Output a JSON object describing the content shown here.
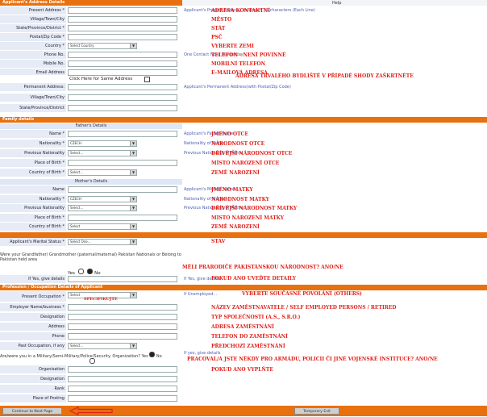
{
  "sections": {
    "applicant_address": "Applicant's Address Details",
    "family": "Family details",
    "profession": "Profession / Occupation Details of Applicant",
    "help": "Help"
  },
  "address_rows": [
    {
      "label": "Present Address *",
      "help": "Applicant's Present Address, Maximum 35 characters (Each Line)",
      "note": "ADRESA KONTAKTNÍ",
      "type": "input"
    },
    {
      "label": "Village/Town/City",
      "help": "",
      "note": "MĚSTO",
      "type": "input"
    },
    {
      "label": "State/Province/District *",
      "help": "",
      "note": "STÁT",
      "type": "input"
    },
    {
      "label": "Postal/Zip Code *",
      "help": "",
      "note": "PSČ",
      "type": "input"
    },
    {
      "label": "Country *",
      "help": "",
      "note": "VYBERTE ZEMI",
      "type": "select",
      "value": "Select Country"
    },
    {
      "label": "Phone No.",
      "help": "One Contact No is Mandatory",
      "note": "TELEFON - NENÍ POVINNÉ",
      "type": "input"
    },
    {
      "label": "Mobile No.",
      "help": "",
      "note": "MOBILNÍ TELEFON",
      "type": "input"
    },
    {
      "label": "Email Address",
      "help": "",
      "note": "E-MAILOVÁ ADRESA",
      "type": "input"
    }
  ],
  "same_address": {
    "text": "Click Here for Same Address",
    "note": "ADRESA TRVALÉHO BYDLIŠTĚ V PŘÍPADĚ SHODY ZAŠKRTNĚTE"
  },
  "permanent_rows": [
    {
      "label": "Permanent Address:",
      "help": "Applicant's Permanent Address(with Postal/Zip Code)"
    },
    {
      "label": "Village/Town/City",
      "help": ""
    },
    {
      "label": "State/Province/District",
      "help": ""
    }
  ],
  "father": {
    "title": "Father's Details",
    "rows": [
      {
        "label": "Name *",
        "help": "Applicant's Father Name",
        "note": "JMÉNO OTCE",
        "type": "input"
      },
      {
        "label": "Nationality *",
        "help": "Nationality of Father",
        "note": "NÁRODNOST OTCE",
        "type": "select",
        "value": "CZECH"
      },
      {
        "label": "Previous Nationality",
        "help": "Previous Nationality of Father",
        "note": "DŘÍVĚJŠÍ NÁRODNOST OTCE",
        "type": "select",
        "value": "Select..."
      },
      {
        "label": "Place of Birth *",
        "help": "",
        "note": "MÍSTO NAROZENÍ OTCE",
        "type": "input"
      },
      {
        "label": "Country of Birth *",
        "help": "",
        "note": "ZEMĚ NAROZENÍ",
        "type": "select",
        "value": "Select..."
      }
    ]
  },
  "mother": {
    "title": "Mother's Details",
    "rows": [
      {
        "label": "Name",
        "help": "Applicant's Mother Name",
        "note": "JMÉNO MATKY",
        "type": "input"
      },
      {
        "label": "Nationality *",
        "help": "Nationality of Mother",
        "note": "NÁRODNOST MATKY",
        "type": "select",
        "value": "CZECH"
      },
      {
        "label": "Previous Nationality",
        "help": "Previous Nationality of Mother",
        "note": "DŘÍVĚJŠÍ NÁRODNOST MATKY",
        "type": "select",
        "value": "Select..."
      },
      {
        "label": "Place of Birth *",
        "help": "",
        "note": "MÍSTO NAROZENÍ MATKY",
        "type": "input"
      },
      {
        "label": "Country of Birth *",
        "help": "",
        "note": "ZEMĚ NAROZENÍ",
        "type": "select",
        "value": "Select"
      }
    ]
  },
  "marital": {
    "label": "Applicant's Marital Status *",
    "value": "Select One...",
    "note": "STAV"
  },
  "pakistan": {
    "question": "Were your Grandfather/ Grandmother (paternal/maternal) Pakistan Nationals or Belong to Pakistan held area",
    "yes": "Yes",
    "no": "No",
    "note": "MĚLI PRARODIČE PÁKISTÁNSKOU NÁRODNOST? ANO/NE",
    "details_label": "If Yes, give details",
    "details_help": "If Yes, give details",
    "details_note": "POKUD ANO UVEĎTE DETAILY"
  },
  "profession": {
    "present": {
      "label": "Present Occupation *",
      "value": "Select",
      "help": "If Unemployed...",
      "note": "VYBERTE SOUČASNÉ POVOLÁNÍ (OTHERS)",
      "specify": "SPECIFIKUJTE"
    },
    "rows": [
      {
        "label": "Employer Name/business *",
        "help": "",
        "note": "NÁZEV ZAMĚSTNAVATELE / SELF EMPLOYED PERSONS / RETIRED",
        "type": "input"
      },
      {
        "label": "Designation",
        "help": "",
        "note": "TYP SPOLEČNOSTI (A.S., S.R.O.)",
        "type": "input"
      },
      {
        "label": "Address",
        "help": "",
        "note": "ADRESA ZAMĚSTNÁNÍ",
        "type": "input"
      },
      {
        "label": "Phone",
        "help": "",
        "note": "TELEFON DO ZAMĚSTNÁNÍ",
        "type": "input"
      },
      {
        "label": "Past Occupation, if any",
        "help": "",
        "note": "PŘEDCHOZÍ ZAMĚSTNÁNÍ",
        "type": "select",
        "value": "Select..."
      }
    ],
    "military": {
      "question": "Are/were you in a Military/Semi-Military/Police/Security. Organization?",
      "yes": "Yes",
      "no": "No",
      "help": "If yes, give details",
      "note": "PRACOVAL/A JSTE NĚKDY PRO ARMÁDU, POLICII ČI JINÉ VOJENSKÉ INSTITUCE? ANO/NE"
    },
    "military_rows": [
      {
        "label": "Organisation",
        "note": "POKUD ANO VYPLŇTE"
      },
      {
        "label": "Designation",
        "note": ""
      },
      {
        "label": "Rank",
        "note": ""
      },
      {
        "label": "Place of Posting",
        "note": ""
      }
    ]
  },
  "buttons": {
    "continue": "Continue to Next Page",
    "temp_exit": "Temporary Exit"
  },
  "colors": {
    "section": "#e8700e",
    "label_bg": "#e6ebf6",
    "annotation": "#e0211a",
    "help": "#4a5db5"
  }
}
